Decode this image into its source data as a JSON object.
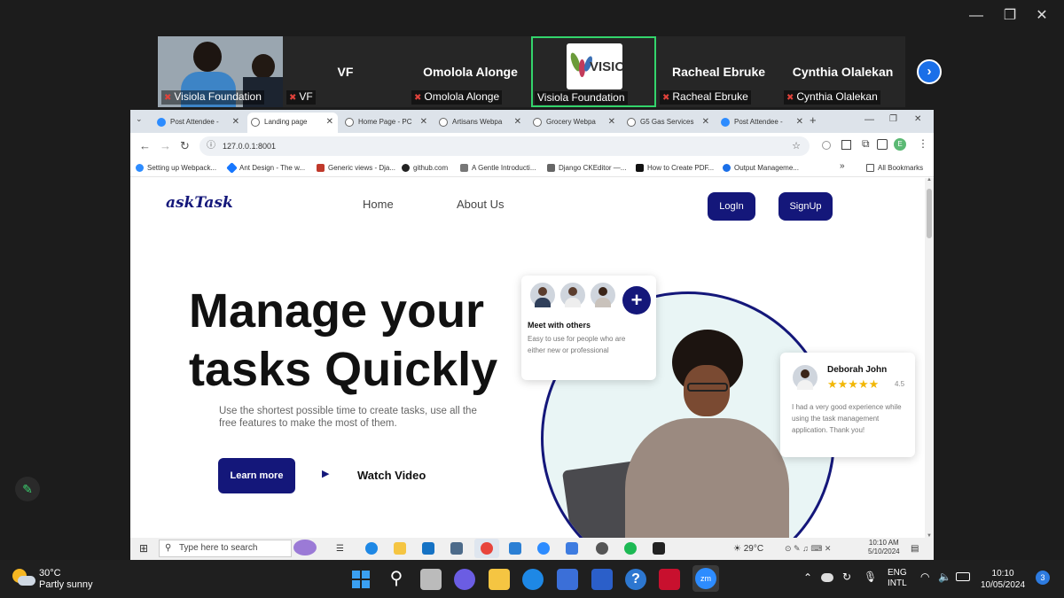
{
  "window_controls": {
    "minimize": "—",
    "restore": "❐",
    "close": "✕"
  },
  "participants": [
    {
      "name": "",
      "label": "Visiola Foundation",
      "video": "camera"
    },
    {
      "name": "VF",
      "label": "VF",
      "video": "none"
    },
    {
      "name": "Omolola Alonge",
      "label": "Omolola Alonge",
      "video": "none"
    },
    {
      "name": "",
      "label": "Visiola Foundation",
      "video": "logo",
      "logo_text": "VISIO"
    },
    {
      "name": "Racheal Ebruke",
      "label": "Racheal Ebruke",
      "video": "none"
    },
    {
      "name": "Cynthia Olalekan",
      "label": "Cynthia Olalekan",
      "video": "none"
    }
  ],
  "gallery_next_icon": "chevron-right-icon",
  "tabs": [
    {
      "title": "Post Attendee -",
      "icon": "zoom"
    },
    {
      "title": "Landing page",
      "icon": "globe",
      "active": true
    },
    {
      "title": "Home Page - PC",
      "icon": "globe"
    },
    {
      "title": "Artisans Webpa",
      "icon": "globe"
    },
    {
      "title": "Grocery Webpa",
      "icon": "globe"
    },
    {
      "title": "G5 Gas Services",
      "icon": "globe"
    },
    {
      "title": "Post Attendee -",
      "icon": "zoom"
    }
  ],
  "new_tab": "+",
  "address": "127.0.0.1:8001",
  "profile_initial": "E",
  "bookmarks": [
    "Setting up Webpack...",
    "Ant Design - The w...",
    "Generic views - Dja...",
    "github.com",
    "A Gentle Introducti...",
    "Django CKEditor —...",
    "How to Create PDF...",
    "Output Manageme..."
  ],
  "bookmarks_more": "»",
  "all_bookmarks": "All Bookmarks",
  "site": {
    "logo": "askTask",
    "nav": [
      "Home",
      "About Us"
    ],
    "login": "LogIn",
    "signup": "SignUp",
    "hero_line1": "Manage your",
    "hero_line2": "tasks Quickly",
    "subtitle": "Use the shortest possible time to create tasks, use all the free features to make the most of them.",
    "learn_more": "Learn more",
    "watch_video": "Watch Video",
    "meet_card": {
      "title": "Meet with others",
      "desc": "Easy to use for people who are either new or professional",
      "plus": "+"
    },
    "review_card": {
      "name": "Deborah John",
      "stars": 5,
      "rating": "4.5",
      "text": "I had a very good experience while using the task management application. Thank you!"
    }
  },
  "inner_taskbar": {
    "search": "Type here to search",
    "weather": "29°C",
    "time": "10:10 AM",
    "date": "5/10/2024"
  },
  "taskbar": {
    "temp": "30°C",
    "weather": "Partly sunny",
    "lang1": "ENG",
    "lang2": "INTL",
    "time": "10:10",
    "date": "10/05/2024",
    "badge": "3"
  },
  "colors": {
    "brand": "#14177a",
    "star": "#f2b705",
    "zoom_blue": "#1a6fe8",
    "active_green": "#33d46c"
  }
}
